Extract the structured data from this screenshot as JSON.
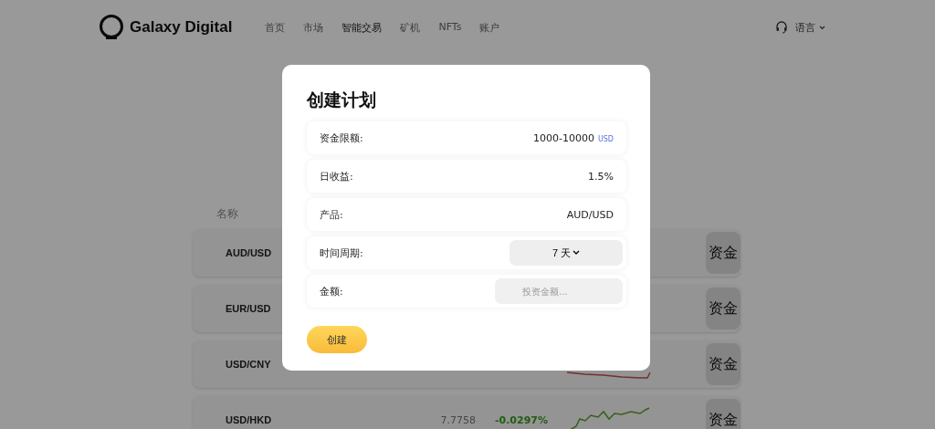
{
  "header": {
    "brand": "Galaxy Digital",
    "nav": [
      {
        "label": "首页",
        "selected": false
      },
      {
        "label": "市场",
        "selected": false
      },
      {
        "label": "智能交易",
        "selected": true
      },
      {
        "label": "矿机",
        "selected": false
      },
      {
        "label": "NFTs",
        "selected": false
      },
      {
        "label": "账户",
        "selected": false
      }
    ],
    "language": "语言"
  },
  "page": {
    "column_header": "名称",
    "rows": [
      {
        "name": "AUD/USD",
        "action": "资金"
      },
      {
        "name": "EUR/USD",
        "action": "资金"
      },
      {
        "name": "USD/CNY",
        "color": "#733030",
        "action": "资金"
      },
      {
        "name": "USD/HKD",
        "price": "7.7758",
        "change": "-0.0297%",
        "color": "#365f19",
        "action": "资金"
      }
    ]
  },
  "dialog": {
    "title": "创建计划",
    "fields": [
      {
        "kind": "text",
        "label": "资金限额:",
        "value": "1000-10000",
        "unit": "USD"
      },
      {
        "kind": "text",
        "label": "日收益:",
        "value": "1.5%"
      },
      {
        "kind": "text",
        "label": "产品:",
        "value": "AUD/USD"
      },
      {
        "kind": "select",
        "label": "时间周期:",
        "value": "7 天"
      },
      {
        "kind": "input",
        "label": "金额:",
        "placeholder": "投资金额..."
      }
    ],
    "submit": "创建"
  }
}
